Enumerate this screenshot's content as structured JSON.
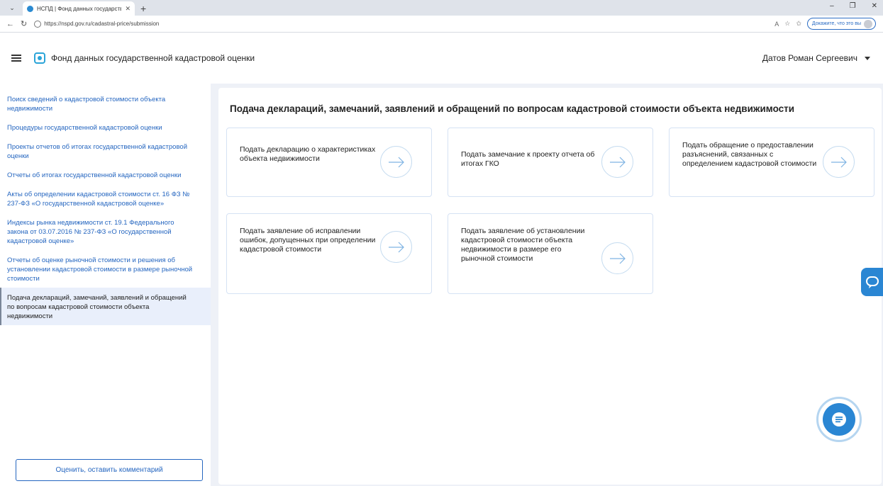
{
  "browser": {
    "tab_title": "НСПД | Фонд данных государстве",
    "tab_close": "✕",
    "new_tab": "+",
    "url": "https://nspd.gov.ru/cadastral-price/submission",
    "prove_label": "Докажите, что это вы",
    "reader_glyph": "A",
    "star_glyph": "☆"
  },
  "header": {
    "app_title": "Фонд данных государственной кадастровой оценки",
    "user_name": "Датов Роман Сергеевич"
  },
  "sidebar": {
    "items": [
      {
        "label": "Поиск сведений о кадастровой стоимости объекта недвижимости"
      },
      {
        "label": "Процедуры государственной кадастровой оценки"
      },
      {
        "label": "Проекты отчетов об итогах государственной кадастровой оценки"
      },
      {
        "label": "Отчеты об итогах государственной кадастровой оценки"
      },
      {
        "label": "Акты об определении кадастровой стоимости ст. 16 ФЗ № 237-ФЗ «О государственной кадастровой оценке»"
      },
      {
        "label": "Индексы рынка недвижимости ст. 19.1 Федерального закона от 03.07.2016 № 237-ФЗ «О государственной кадастровой оценке»"
      },
      {
        "label": "Отчеты об оценке рыночной стоимости и решения об установлении кадастровой стоимости в размере рыночной стоимости"
      },
      {
        "label": "Подача деклараций, замечаний, заявлений и обращений по вопросам кадастровой стоимости объекта недвижимости"
      }
    ],
    "rate_button": "Оценить, оставить комментарий"
  },
  "main": {
    "title": "Подача деклараций, замечаний, заявлений и обращений по вопросам кадастровой стоимости объекта недвижимости",
    "cards": [
      {
        "label": "Подать декларацию о характеристиках объекта недвижимости"
      },
      {
        "label": "Подать замечание к проекту отчета об итогах ГКО"
      },
      {
        "label": "Подать обращение о предоставлении разъяснений, связанных с определением кадастровой стоимости"
      },
      {
        "label": "Подать заявление об исправлении ошибок, допущенных при определении кадастровой стоимости"
      },
      {
        "label": "Подать заявление об установлении кадастровой стоимости объекта недвижимости в размере его рыночной стоимости"
      }
    ]
  },
  "colors": {
    "accent": "#2566c0",
    "chat": "#2a86d3"
  }
}
